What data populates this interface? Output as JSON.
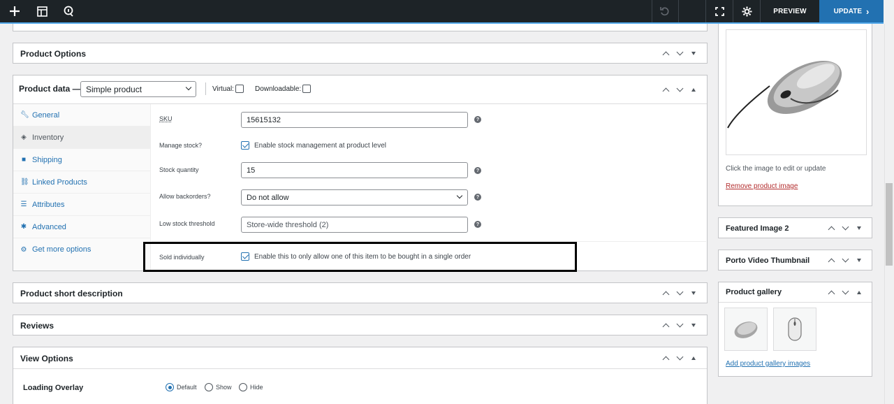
{
  "toolbar": {
    "preview_label": "PREVIEW",
    "update_label": "UPDATE"
  },
  "product_options": {
    "title": "Product Options"
  },
  "product_data": {
    "title": "Product data —",
    "type_selected": "Simple product",
    "virtual_label": "Virtual:",
    "downloadable_label": "Downloadable:",
    "tabs": [
      {
        "label": "General",
        "icon": "wrench-icon"
      },
      {
        "label": "Inventory",
        "icon": "tag-icon"
      },
      {
        "label": "Shipping",
        "icon": "truck-icon"
      },
      {
        "label": "Linked Products",
        "icon": "link-icon"
      },
      {
        "label": "Attributes",
        "icon": "list-icon"
      },
      {
        "label": "Advanced",
        "icon": "gear-icon"
      },
      {
        "label": "Get more options",
        "icon": "plugin-icon"
      }
    ],
    "inventory": {
      "sku_label": "SKU",
      "sku_value": "15615132",
      "manage_stock_label": "Manage stock?",
      "manage_stock_text": "Enable stock management at product level",
      "stock_qty_label": "Stock quantity",
      "stock_qty_value": "15",
      "backorders_label": "Allow backorders?",
      "backorders_value": "Do not allow",
      "low_stock_label": "Low stock threshold",
      "low_stock_placeholder": "Store-wide threshold (2)",
      "sold_individually_label": "Sold individually",
      "sold_individually_text": "Enable this to only allow one of this item to be bought in a single order"
    }
  },
  "short_description": {
    "title": "Product short description"
  },
  "reviews": {
    "title": "Reviews"
  },
  "view_options": {
    "title": "View Options",
    "loading_overlay_label": "Loading Overlay",
    "options": [
      "Default",
      "Show",
      "Hide"
    ],
    "selected": "Default"
  },
  "product_image": {
    "hint": "Click the image to edit or update",
    "remove_label": "Remove product image"
  },
  "featured_image_2": {
    "title": "Featured Image 2"
  },
  "video_thumbnail": {
    "title": "Porto Video Thumbnail"
  },
  "gallery": {
    "title": "Product gallery",
    "add_label": "Add product gallery images"
  },
  "colors": {
    "toolbar_bg": "#1d2327",
    "accent": "#2271b1",
    "remove_link": "#b32d2e",
    "highlight_border": "#000000"
  }
}
